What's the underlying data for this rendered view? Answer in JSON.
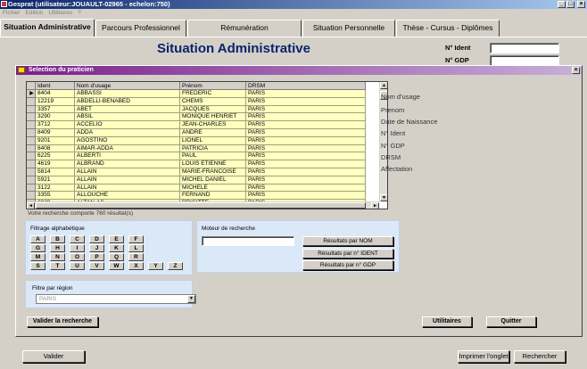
{
  "window": {
    "title": "Gesprat (utilisateur:JOUAULT-02965 - echelon:750)"
  },
  "menu": [
    "Fichier",
    "Edition",
    "Utilitaires",
    "?"
  ],
  "tabs": [
    "Situation Administrative",
    "Parcours Professionnel",
    "Rémunération",
    "Situation Personnelle",
    "Thèse - Cursus - Diplômes"
  ],
  "header": {
    "title": "Situation Administrative",
    "ident_label": "N° Ident",
    "gdp_label": "N° GDP",
    "ident_value": "",
    "gdp_value": ""
  },
  "dialog": {
    "title": "Selection du praticien",
    "columns": [
      "Ident",
      "Nom d'usage",
      "Prénom",
      "DRSM"
    ],
    "rows": [
      [
        "8404",
        "ABBASSI",
        "FREDERIC",
        "PARIS"
      ],
      [
        "12219",
        "ABDELLI-BENABED",
        "CHEMS",
        "PARIS"
      ],
      [
        "3357",
        "ABET",
        "JACQUES",
        "PARIS"
      ],
      [
        "3290",
        "ABSIL",
        "MONIQUE HENRIET",
        "PARIS"
      ],
      [
        "3712",
        "ACCELIO",
        "JEAN-CHARLES",
        "PARIS"
      ],
      [
        "8409",
        "ADDA",
        "ANDRE",
        "PARIS"
      ],
      [
        "9201",
        "AGOSTINO",
        "LIONEL",
        "PARIS"
      ],
      [
        "8408",
        "AIMAR-ADDA",
        "PATRICIA",
        "PARIS"
      ],
      [
        "6225",
        "ALBERTI",
        "PAUL",
        "PARIS"
      ],
      [
        "4619",
        "ALBRAND",
        "LOUIS ETIENNE",
        "PARIS"
      ],
      [
        "5814",
        "ALLAIN",
        "MARIE-FRANCOISE",
        "PARIS"
      ],
      [
        "5921",
        "ALLAIN",
        "MICHEL DANIEL",
        "PARIS"
      ],
      [
        "3122",
        "ALLAIN",
        "MICHELE",
        "PARIS"
      ],
      [
        "3355",
        "ALLOUCHE",
        "FERNAND",
        "PARIS"
      ],
      [
        "2029",
        "ALTAN-AS",
        "BRIGITTE",
        "PARIS"
      ]
    ],
    "result_text": "Votre recherche comporte 760 résultat(s)",
    "side_labels": [
      "Nom d'usage",
      "Prenom",
      "Date de Naissance",
      "N° Ident",
      "N° GDP",
      "DRSM",
      "Affectation"
    ],
    "alpha": {
      "title": "Filtrage alphabétique",
      "letters": [
        "A",
        "B",
        "C",
        "D",
        "E",
        "F",
        "G",
        "H",
        "I",
        "J",
        "K",
        "L",
        "M",
        "N",
        "O",
        "P",
        "Q",
        "R",
        "S",
        "T",
        "U",
        "V",
        "W",
        "X",
        "Y",
        "Z"
      ]
    },
    "search": {
      "title": "Moteur de recherche",
      "value": "",
      "btn_nom": "Résultats par NOM",
      "btn_ident": "Résultats par n° IDENT",
      "btn_gdp": "Résultats par n° GDP"
    },
    "region": {
      "title": "Filtre par région",
      "value": "PARIS"
    },
    "validate_btn": "Valider la recherche",
    "utilities_btn": "Utilitaires",
    "quit_btn": "Quitter"
  },
  "footer": {
    "valider": "Valider",
    "imprimer": "Imprimer l'onglet",
    "rechercher": "Rechercher"
  }
}
